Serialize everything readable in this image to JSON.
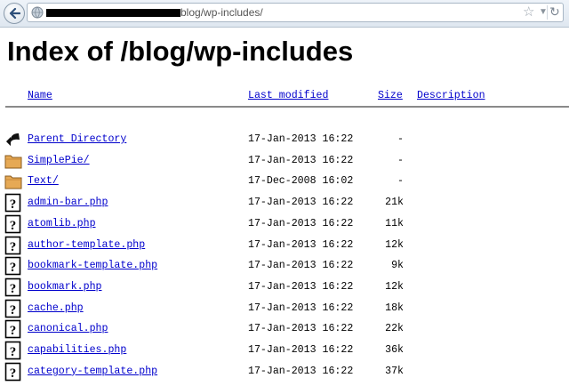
{
  "browser": {
    "url_visible": "blog/wp-includes/"
  },
  "page": {
    "title": "Index of /blog/wp-includes"
  },
  "columns": {
    "name": "Name",
    "last_modified": "Last modified",
    "size": "Size",
    "description": "Description"
  },
  "entries": [
    {
      "name": "Parent Directory",
      "date": "17-Jan-2013 16:22",
      "size": "-",
      "icon": "back-arrow-icon"
    },
    {
      "name": "SimplePie/",
      "date": "17-Jan-2013 16:22",
      "size": "-",
      "icon": "folder-icon"
    },
    {
      "name": "Text/",
      "date": "17-Dec-2008 16:02",
      "size": "-",
      "icon": "folder-icon"
    },
    {
      "name": "admin-bar.php",
      "date": "17-Jan-2013 16:22",
      "size": "21k",
      "icon": "unknown-file-icon"
    },
    {
      "name": "atomlib.php",
      "date": "17-Jan-2013 16:22",
      "size": "11k",
      "icon": "unknown-file-icon"
    },
    {
      "name": "author-template.php",
      "date": "17-Jan-2013 16:22",
      "size": "12k",
      "icon": "unknown-file-icon"
    },
    {
      "name": "bookmark-template.php",
      "date": "17-Jan-2013 16:22",
      "size": "9k",
      "icon": "unknown-file-icon"
    },
    {
      "name": "bookmark.php",
      "date": "17-Jan-2013 16:22",
      "size": "12k",
      "icon": "unknown-file-icon"
    },
    {
      "name": "cache.php",
      "date": "17-Jan-2013 16:22",
      "size": "18k",
      "icon": "unknown-file-icon"
    },
    {
      "name": "canonical.php",
      "date": "17-Jan-2013 16:22",
      "size": "22k",
      "icon": "unknown-file-icon"
    },
    {
      "name": "capabilities.php",
      "date": "17-Jan-2013 16:22",
      "size": "36k",
      "icon": "unknown-file-icon"
    },
    {
      "name": "category-template.php",
      "date": "17-Jan-2013 16:22",
      "size": "37k",
      "icon": "unknown-file-icon"
    }
  ]
}
